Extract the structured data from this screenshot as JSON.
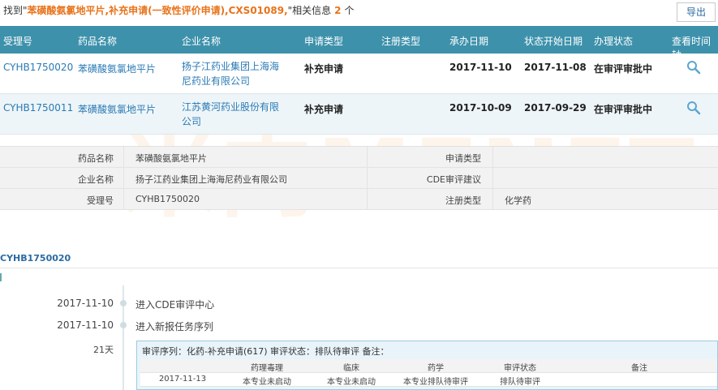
{
  "search": {
    "prefix": "找到\"",
    "query": "苯磺酸氨氯地平片,补充申请(一致性评价申请),CXS01089,",
    "suffix": "\"相关信息",
    "count": "2",
    "unit": "个"
  },
  "toolbar": {
    "export_label": "导出"
  },
  "watermark": {
    "text": "米内MENET"
  },
  "results": {
    "headers": [
      "受理号",
      "药品名称",
      "企业名称",
      "申请类型",
      "注册类型",
      "承办日期",
      "状态开始日期",
      "办理状态",
      "查看时间轴"
    ],
    "rows": [
      {
        "id": "CYHB1750020",
        "name": "苯磺酸氨氯地平片",
        "company": "扬子江药业集团上海海尼药业有限公司",
        "apply_type": "补充申请",
        "reg_type": "",
        "date": "2017-11-10",
        "status_date": "2017-11-08",
        "status": "在审评审批中"
      },
      {
        "id": "CYHB1750011",
        "name": "苯磺酸氨氯地平片",
        "company": "江苏黄河药业股份有限公司",
        "apply_type": "补充申请",
        "reg_type": "",
        "date": "2017-10-09",
        "status_date": "2017-09-29",
        "status": "在审评审批中"
      }
    ]
  },
  "detail": {
    "drug_label": "药品名称",
    "drug_value": "苯磺酸氨氯地平片",
    "company_label": "企业名称",
    "company_value": "扬子江药业集团上海海尼药业有限公司",
    "id_label": "受理号",
    "id_value": "CYHB1750020",
    "apply_label": "申请类型",
    "apply_value": "",
    "cde_label": "CDE审评建议",
    "cde_value": "",
    "reg_label": "注册类型",
    "reg_value": "化学药"
  },
  "timeline": {
    "title": "CYHB1750020",
    "events": [
      {
        "date": "2017-11-10",
        "text": "进入CDE审评中心"
      },
      {
        "date": "2017-11-10",
        "text": "进入新报任务序列"
      }
    ],
    "duration": "21天",
    "review": {
      "header": "审评序列：化药-补充申请(617)  审评状态：排队待审评  备注：",
      "columns": [
        "",
        "药理毒理",
        "临床",
        "药学",
        "审评状态",
        "备注"
      ],
      "row": [
        "2017-11-13",
        "本专业未启动",
        "本专业未启动",
        "本专业排队待审评",
        "排队待审评",
        ""
      ]
    }
  },
  "colors": {
    "header_bg": "#3d91ab",
    "accent": "#e8731a",
    "link": "#2a7ab5"
  }
}
